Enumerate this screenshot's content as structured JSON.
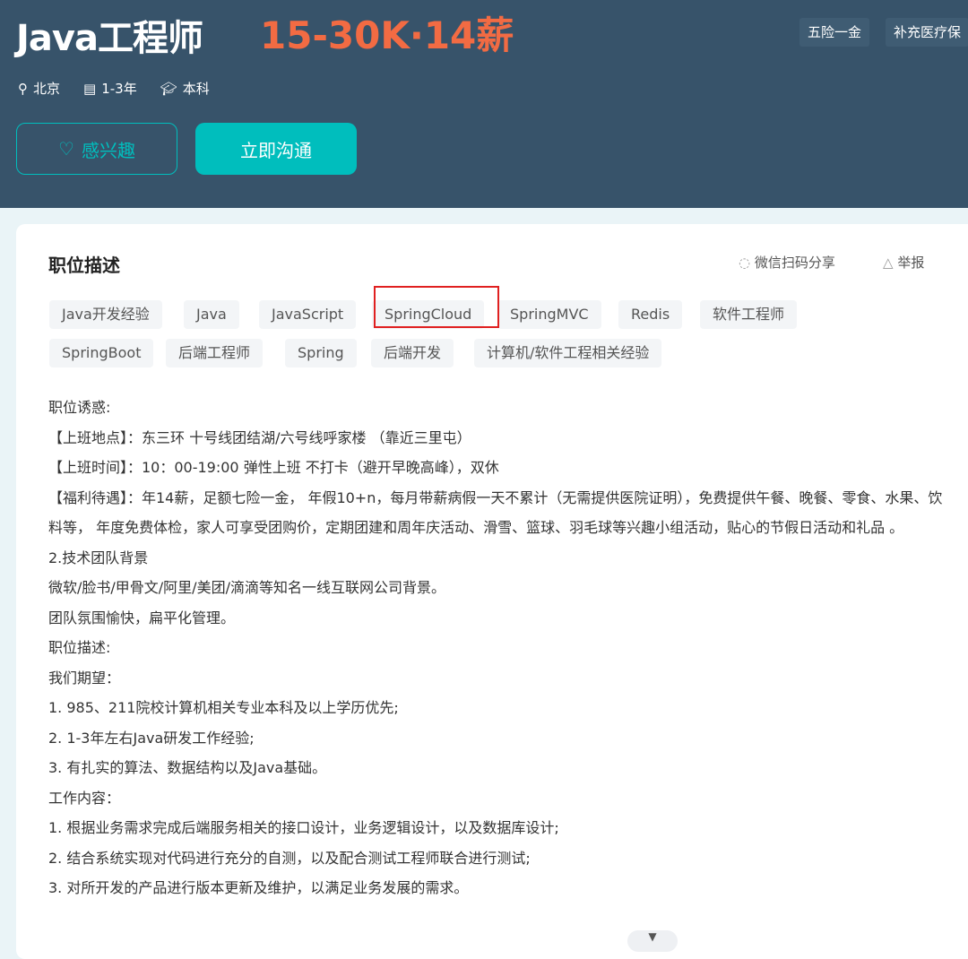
{
  "job": {
    "title": "Java工程师",
    "salary": "15-30K·14薪",
    "perks": [
      "五险一金",
      "补充医疗保"
    ],
    "city": "北京",
    "experience": "1-3年",
    "degree": "本科"
  },
  "buttons": {
    "interest": "感兴趣",
    "chat": "立即沟通"
  },
  "card": {
    "title": "职位描述",
    "share": "微信扫码分享",
    "report": "举报",
    "tags": [
      "Java开发经验",
      "Java",
      "JavaScript",
      "SpringCloud",
      "SpringMVC",
      "Redis",
      "软件工程师",
      "SpringBoot",
      "后端工程师",
      "Spring",
      "后端开发",
      "计算机/软件工程相关经验"
    ],
    "highlight_color": "#e02020",
    "lines": [
      "职位诱惑:",
      "【上班地点】：东三环 十号线团结湖/六号线呼家楼 （靠近三里屯）",
      "【上班时间】：10：00-19:00 弹性上班 不打卡（避开早晚高峰），双休",
      "【福利待遇】：年14薪，足额七险一金， 年假10+n，每月带薪病假一天不累计（无需提供医院证明），免费提供午餐、晚餐、零食、水果、饮料等， 年度免费体检，家人可享受团购价，定期团建和周年庆活动、滑雪、篮球、羽毛球等兴趣小组活动，贴心的节假日活动和礼品 。",
      "2.技术团队背景",
      "微软/脸书/甲骨文/阿里/美团/滴滴等知名一线互联网公司背景。",
      "团队氛围愉快，扁平化管理。",
      "职位描述:",
      "我们期望：",
      " 1. 985、211院校计算机相关专业本科及以上学历优先;",
      " 2. 1-3年左右Java研发工作经验;",
      " 3. 有扎实的算法、数据结构以及Java基础。",
      "工作内容：",
      " 1. 根据业务需求完成后端服务相关的接口设计，业务逻辑设计，以及数据库设计;",
      " 2. 结合系统实现对代码进行充分的自测，以及配合测试工程师联合进行测试;",
      " 3. 对所开发的产品进行版本更新及维护，以满足业务发展的需求。"
    ]
  }
}
